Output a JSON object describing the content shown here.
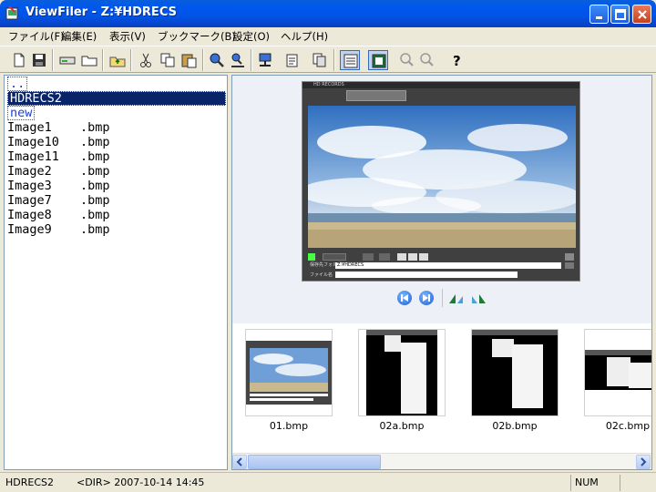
{
  "window": {
    "title": "ViewFiler - Z:¥HDRECS"
  },
  "menu": [
    {
      "label": "ファイル(F)"
    },
    {
      "label": "編集(E)"
    },
    {
      "label": "表示(V)"
    },
    {
      "label": "ブックマーク(B)"
    },
    {
      "label": "設定(O)"
    },
    {
      "label": "ヘルプ(H)"
    }
  ],
  "toolbar": {
    "icons": [
      "new-file-icon",
      "save-icon",
      "drive-icon",
      "folder-icon",
      "parent-folder-icon",
      "cut-icon",
      "copy-icon",
      "paste-icon",
      "search-icon",
      "find-next-icon",
      "network-icon",
      "properties-icon",
      "duplicate-icon",
      "list-view-icon",
      "thumbnail-view-icon",
      "zoom-in-icon",
      "zoom-out-icon",
      "help-icon"
    ]
  },
  "file_list": {
    "items": [
      {
        "name": "..",
        "ext": "",
        "type": "dir"
      },
      {
        "name": "HDRECS2",
        "ext": "",
        "type": "dir",
        "selected": true
      },
      {
        "name": "new",
        "ext": "",
        "type": "dir"
      },
      {
        "name": "Image1",
        "ext": ".bmp",
        "type": "file"
      },
      {
        "name": "Image10",
        "ext": ".bmp",
        "type": "file"
      },
      {
        "name": "Image11",
        "ext": ".bmp",
        "type": "file"
      },
      {
        "name": "Image2",
        "ext": ".bmp",
        "type": "file"
      },
      {
        "name": "Image3",
        "ext": ".bmp",
        "type": "file"
      },
      {
        "name": "Image7",
        "ext": ".bmp",
        "type": "file"
      },
      {
        "name": "Image8",
        "ext": ".bmp",
        "type": "file"
      },
      {
        "name": "Image9",
        "ext": ".bmp",
        "type": "file"
      }
    ]
  },
  "preview": {
    "shot_title": "HD RECORDS",
    "folder_label": "保存先フォルダ",
    "folder_value": "Z:¥HDRECS",
    "file_label": "ファイル名"
  },
  "thumbnails": [
    {
      "label": "01.bmp"
    },
    {
      "label": "02a.bmp"
    },
    {
      "label": "02b.bmp"
    },
    {
      "label": "02c.bmp"
    }
  ],
  "status": {
    "name": "HDRECS2",
    "info": "<DIR> 2007-10-14 14:45",
    "num": "NUM"
  },
  "colors": {
    "titlebar": "#0054e3",
    "selection": "#0a246a",
    "dir_text": "#1a3fd8"
  }
}
